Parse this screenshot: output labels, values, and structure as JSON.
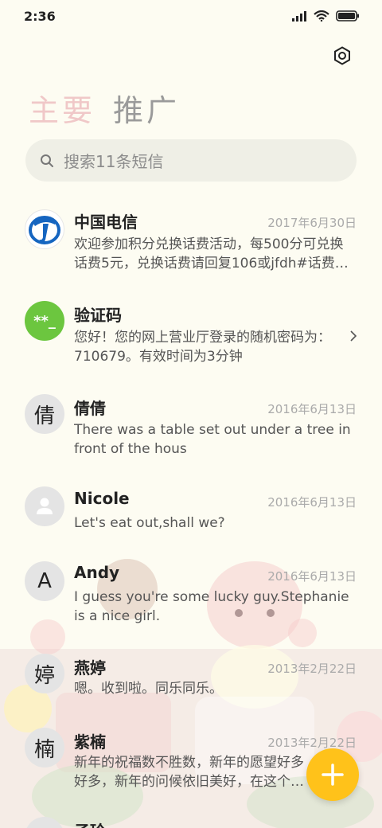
{
  "status_bar": {
    "time": "2:36"
  },
  "header": {
    "tabs": [
      {
        "label": "主要"
      },
      {
        "label": "推广"
      }
    ]
  },
  "search": {
    "placeholder": "搜索11条短信"
  },
  "conversations": [
    {
      "name": "中国电信",
      "date": "2017年6月30日",
      "preview": "欢迎参加积分兑换话费活动，每500分可兑换话费5元，兑换话费请回复106或jfdh#话费…",
      "avatar": "china-telecom-logo"
    },
    {
      "name": "验证码",
      "date": "",
      "preview": "您好！您的网上营业厅登录的随机密码为：710679。有效时间为3分钟",
      "avatar_text": "**_"
    },
    {
      "name": "倩倩",
      "date": "2016年6月13日",
      "preview": "There was a table set out under a tree in front of the hous",
      "avatar_text": "倩"
    },
    {
      "name": "Nicole",
      "date": "2016年6月13日",
      "preview": "Let's eat out,shall we?",
      "avatar": "person-icon"
    },
    {
      "name": "Andy",
      "date": "2016年6月13日",
      "preview": "I guess you're some lucky guy.Stephanie is a nice girl.",
      "avatar_text": "A"
    },
    {
      "name": "燕婷",
      "date": "2013年2月22日",
      "preview": "嗯。收到啦。同乐同乐。",
      "avatar_text": "婷"
    },
    {
      "name": "紫楠",
      "date": "2013年2月22日",
      "preview": "新年的祝福数不胜数，新年的愿望好多好多，新年的问候依旧美好，在这个温馨的时刻",
      "avatar_text": "楠"
    },
    {
      "name": "子玲",
      "date": "",
      "preview": "",
      "avatar_text": ""
    }
  ],
  "colors": {
    "background": "#fdfcf2",
    "accent_fab": "#ffc21a",
    "tab_active": "#f0c8c8",
    "verify_avatar": "#6cc63f",
    "telecom_blue": "#1565c0"
  }
}
